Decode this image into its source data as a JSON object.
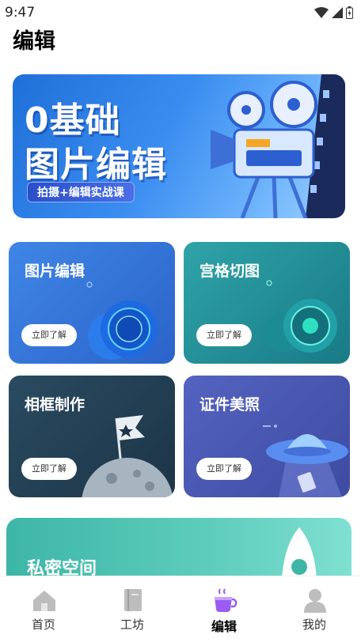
{
  "status": {
    "time": "9:47"
  },
  "page": {
    "title": "编辑"
  },
  "banner": {
    "line1": "0基础",
    "line2": "图片编辑",
    "tag": "拍摄+编辑实战课"
  },
  "cards": [
    {
      "title": "图片编辑",
      "button": "立即了解",
      "icon": "lens-icon"
    },
    {
      "title": "宫格切图",
      "button": "立即了解",
      "icon": "camera-lens-icon"
    },
    {
      "title": "相框制作",
      "button": "立即了解",
      "icon": "moon-flag-icon"
    },
    {
      "title": "证件美照",
      "button": "立即了解",
      "icon": "ufo-icon"
    }
  ],
  "private_space": {
    "title": "私密空间"
  },
  "tabs": [
    {
      "label": "首页",
      "icon": "home-icon",
      "active": false
    },
    {
      "label": "工坊",
      "icon": "book-icon",
      "active": false
    },
    {
      "label": "编辑",
      "icon": "coffee-cup-icon",
      "active": true
    },
    {
      "label": "我的",
      "icon": "profile-icon",
      "active": false
    }
  ],
  "colors": {
    "active_tab": "#9a5cf5",
    "inactive_tab": "#bdbdbd"
  }
}
